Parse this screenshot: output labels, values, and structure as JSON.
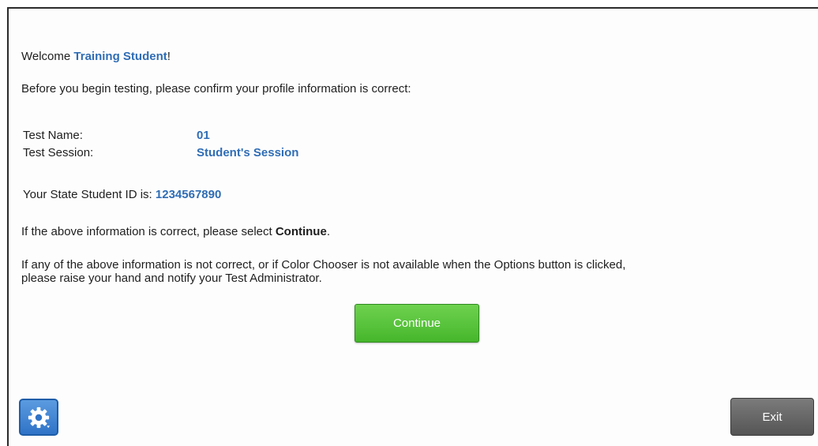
{
  "welcome": {
    "prefix": "Welcome ",
    "name": "Training Student",
    "suffix": "!"
  },
  "intro_text": "Before you begin testing, please confirm your profile information is correct:",
  "info": {
    "rows": [
      {
        "label": "Test Name:",
        "value": "01"
      },
      {
        "label": "Test Session:",
        "value": "Student's Session"
      }
    ]
  },
  "student_id": {
    "label": "Your State Student ID is: ",
    "value": "1234567890"
  },
  "confirm": {
    "prefix": "If the above information is correct, please select ",
    "action": "Continue",
    "suffix": "."
  },
  "note_line1": "If any of the above information is not correct, or if Color Chooser is not available when the Options button is clicked,",
  "note_line2": "please raise your hand and notify your Test Administrator.",
  "buttons": {
    "continue_label": "Continue",
    "exit_label": "Exit",
    "settings_icon": "gear-icon"
  },
  "colors": {
    "accent": "#2f6db5",
    "continue_green": "#46b62c",
    "settings_blue": "#2f73c7",
    "exit_gray": "#5e5e5e"
  }
}
